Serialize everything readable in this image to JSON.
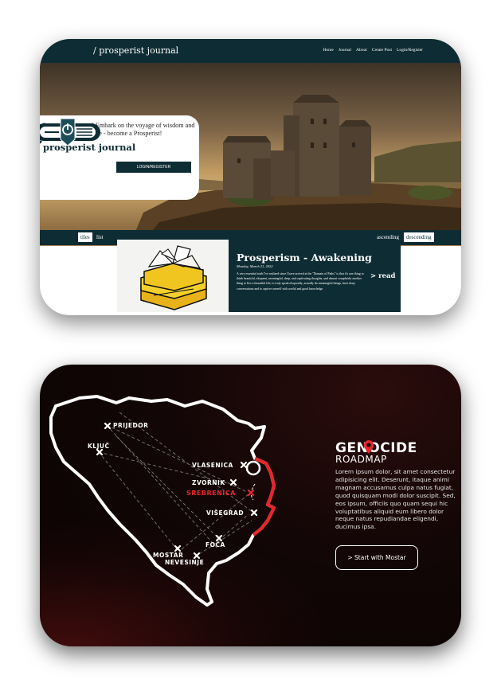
{
  "journal": {
    "brand": "/ prosperist journal",
    "nav": [
      "Home",
      "Journal",
      "About",
      "Create Post",
      "Login/Register"
    ],
    "intro_text": "Peace be upon you! Embark on the voyage of wisdom and eloquence - become a Prosperist!",
    "intro_title": "prosperist journal",
    "login_button": "LOGIN/REGISTER",
    "filters": {
      "tiles": "tiles",
      "list": "list",
      "ascending": "ascending",
      "descending": "descending"
    },
    "post": {
      "title": "Prosperism - Awakening",
      "date": "Monday, March 21, 2022",
      "body": "A very essential truth I've realized since I have arrived at the \"Domain of Paths\" is that it's one thing to think beautiful, eloquent, meaningful, deep, and captivating thoughts, and almost completely another thing to live a beautiful life, to truly speak eloquently, actually do meaningful things, have deep conversations and to captive oneself with useful and good knowledge.",
      "read_label": "> read"
    },
    "colors": {
      "primary": "#0e2c33",
      "background": "#ffffff"
    }
  },
  "roadmap": {
    "title": "GENOCIDE",
    "subtitle": "ROADMAP",
    "description": "Lorem ipsum dolor, sit amet consectetur adipisicing elit. Deserunt, itaque animi magnam accusamus culpa natus fugiat, quod quisquam modi dolor suscipit. Sed, eos ipsum, officiis quo quam sequi hic voluptatibus aliquid eum libero dolor neque natus repudiandae eligendi, ducimus ipsa.",
    "button": "> Start with Mostar",
    "cities": {
      "prijedor": "PRIJEDOR",
      "kljuc": "KLJUČ",
      "vlasenica": "VLASENICA",
      "zvornik": "ZVORNIK",
      "srebrenica": "SREBRENICA",
      "visegrad": "VIŠEGRAD",
      "foca": "FOČA",
      "mostar": "MOSTAR",
      "nevesinje": "NEVESINJE"
    },
    "colors": {
      "accent": "#e8252b",
      "background": "#120606",
      "text": "#ffffff"
    }
  }
}
